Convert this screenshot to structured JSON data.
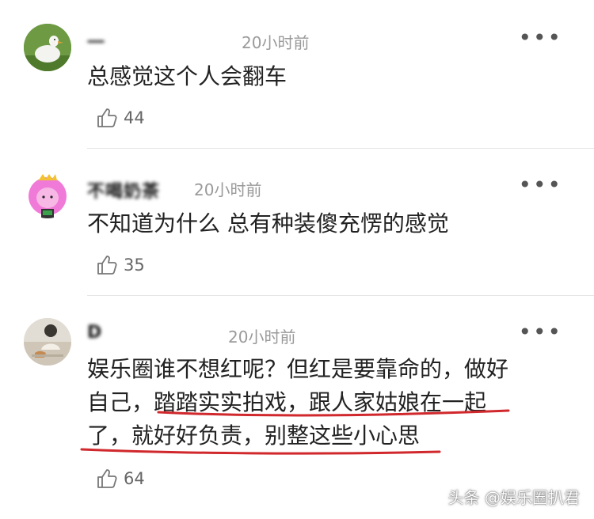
{
  "comments": [
    {
      "username": "一",
      "time": "20小时前",
      "text": "总感觉这个人会翻车",
      "likes": "44",
      "avatar_icon": "duck-avatar-icon"
    },
    {
      "username": "不喝奶茶",
      "time": "20小时前",
      "text": "不知道为什么 总有种装傻充愣的感觉",
      "likes": "35",
      "avatar_icon": "pink-princess-avatar-icon"
    },
    {
      "username": "D",
      "time": "20小时前",
      "text_lines": [
        "娱乐圈谁不想红呢？但红是要靠命的，做好",
        "自己，踏踏实实拍戏，跟人家姑娘在一起",
        "了，就好好负责，别整这些小心思"
      ],
      "likes": "64",
      "avatar_icon": "person-photo-avatar-icon"
    }
  ],
  "more_label": "•••",
  "watermark": "头条 @娱乐圈扒君",
  "colors": {
    "underline": "#d0282c",
    "time": "#9a9a9a",
    "text": "#222222"
  }
}
